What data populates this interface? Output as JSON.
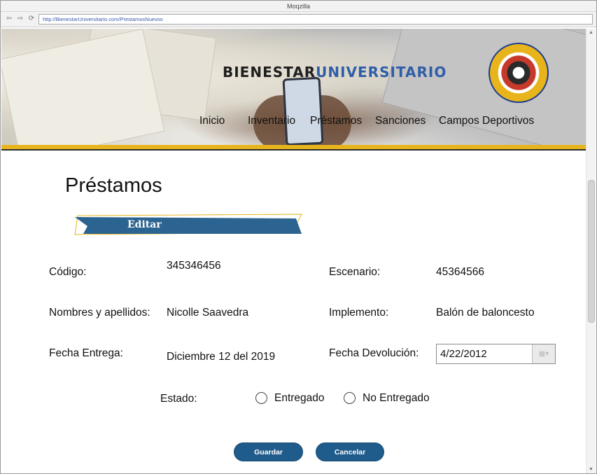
{
  "browser": {
    "title": "Moqzilla",
    "url": "http://BienestarUniversitario.com/PrestamosNuevos",
    "nav_back": "⇦",
    "nav_forward": "⇨",
    "nav_reload": "⟳"
  },
  "header": {
    "brand_part1": "BIENESTAR",
    "brand_part2": "UNIVERSITARIO",
    "nav_items": [
      "Inicio",
      "Inventario",
      "Préstamos",
      "Sanciones",
      "Campos Deportivos"
    ],
    "accent_color": "#e7b41c",
    "brand_blue": "#2f5ea8"
  },
  "page": {
    "title": "Préstamos",
    "ribbon_label": "Editar",
    "ribbon_color": "#2c6491"
  },
  "form": {
    "codigo_label": "Código:",
    "codigo_value": "345346456",
    "escenario_label": "Escenario:",
    "escenario_value": "45364566",
    "nombres_label": "Nombres y apellidos:",
    "nombres_value": "Nicolle Saavedra",
    "implemento_label": "Implemento:",
    "implemento_value": "Balón de baloncesto",
    "fecha_entrega_label": "Fecha Entrega:",
    "fecha_entrega_value": "Diciembre 12 del 2019",
    "fecha_devolucion_label": "Fecha Devolución:",
    "fecha_devolucion_value": "4/22/2012",
    "estado_label": "Estado:",
    "estado_options": [
      "Entregado",
      "No Entregado"
    ],
    "estado_selected": null
  },
  "actions": {
    "save_label": "Guardar",
    "cancel_label": "Cancelar",
    "button_color": "#1f5b8b"
  }
}
